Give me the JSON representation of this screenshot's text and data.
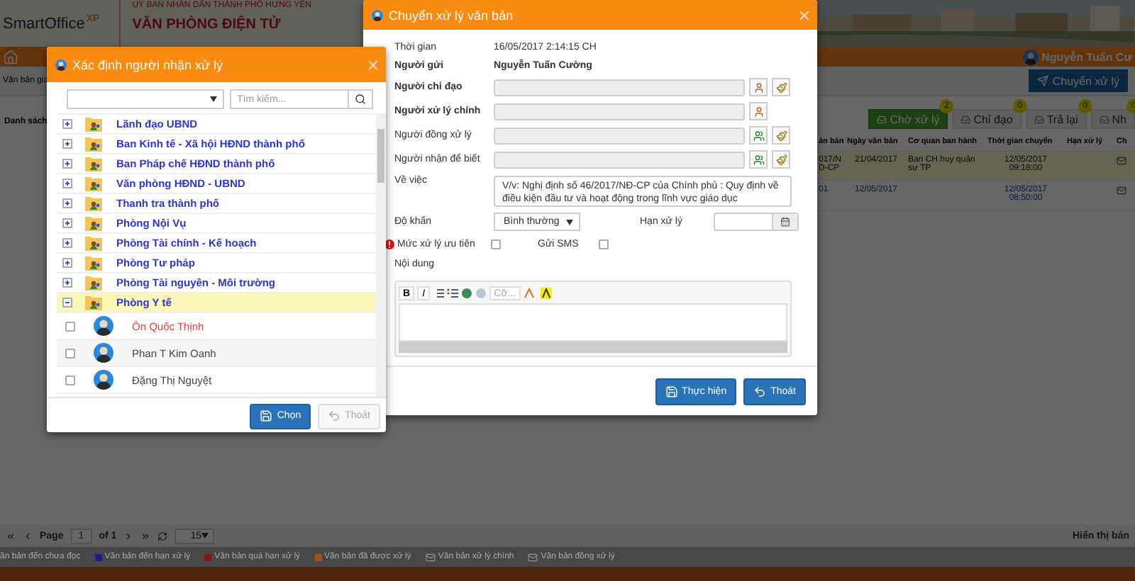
{
  "banner": {
    "logo": "SmartOffice",
    "logo_suffix": "XP",
    "org": "UỶ BAN NHÂN DÂN THÀNH PHỐ HƯNG YÊN",
    "title": "VĂN PHÒNG ĐIỆN TỬ"
  },
  "navbar": {
    "user": "Nguyễn Tuấn Cư"
  },
  "toolbar": {
    "breadcrumb": "Văn bản gia",
    "action": "Chuyển xử lý"
  },
  "list": {
    "title": "Danh sách",
    "tabs": [
      {
        "label": "Chờ xử lý",
        "badge": "2",
        "selected": true
      },
      {
        "label": "Chỉ đạo",
        "badge": "0",
        "selected": false
      },
      {
        "label": "Trả lại",
        "badge": "0",
        "selected": false
      },
      {
        "label": "Nh",
        "badge": "0",
        "selected": false
      }
    ]
  },
  "table": {
    "columns": [
      "ản bản",
      "Ngày văn bản",
      "Cơ quan ban hành",
      "Thời gian chuyển",
      "Hạn xử lý",
      "Ch"
    ],
    "rows": [
      {
        "selected": true,
        "unread": false,
        "number": "017/ND-CP",
        "date": "21/04/2017",
        "issuer": "Ban CH huy quân sự TP",
        "sent": "12/05/2017 09:18:00"
      },
      {
        "selected": false,
        "unread": true,
        "number": "01",
        "date": "12/05/2017",
        "sent": "12/05/2017 08:50:00"
      }
    ]
  },
  "pager": {
    "page_label": "Page",
    "page": "1",
    "of": "of 1",
    "page_size": "15",
    "summary": "Hiển thị bản"
  },
  "legend": [
    {
      "kind": "text",
      "label": "ăn bản đến chưa đọc"
    },
    {
      "kind": "swatch",
      "color": "#1c1c8c",
      "label": "Văn bản đến hạn xử lý"
    },
    {
      "kind": "swatch",
      "color": "#8c1414",
      "label": "Văn bản quá hạn xử lý"
    },
    {
      "kind": "swatch",
      "color": "#a0501c",
      "label": "Văn bản đã được xử lý"
    },
    {
      "kind": "icon",
      "label": "Văn bản xử lý chính"
    },
    {
      "kind": "icon",
      "label": "Văn bản đồng xử lý"
    }
  ],
  "transfer_dialog": {
    "title": "Chuyển xử lý văn bản",
    "fields": [
      {
        "kind": "info",
        "label": "Thời gian",
        "value": "16/05/2017 2:14:15 CH",
        "bold": false
      },
      {
        "kind": "info",
        "label": "Người gửi",
        "value": "Nguyễn Tuấn Cường",
        "bold": true
      },
      {
        "kind": "picker",
        "label": "Người chỉ đạo",
        "bold": true,
        "multiple": false,
        "clearable": true
      },
      {
        "kind": "picker",
        "label": "Người xử lý chính",
        "bold": true,
        "multiple": false,
        "clearable": false
      },
      {
        "kind": "picker",
        "label": "Người đồng xử lý",
        "bold": false,
        "multiple": true,
        "clearable": true
      },
      {
        "kind": "picker",
        "label": "Người nhận để biết",
        "bold": false,
        "multiple": true,
        "clearable": true
      }
    ],
    "subject": {
      "label": "Về việc",
      "value": "V/v: Nghị định số 46/2017/NĐ-CP của Chính phủ : Quy định về điều kiện đầu tư và hoạt động trong lĩnh vực giáo dục"
    },
    "urgency": {
      "label": "Độ khẩn",
      "value": "Bình thường"
    },
    "deadline": {
      "label": "Hạn xử lý"
    },
    "priority": {
      "label": "Mức xử lý ưu tiên",
      "checked": false
    },
    "sms": {
      "label": "Gửi SMS",
      "checked": false
    },
    "content": {
      "label": "Nội dung",
      "bold_tool": "B",
      "italic_tool": "I",
      "size_placeholder": "Cỡ..."
    },
    "buttons": [
      {
        "kind": "save",
        "label": "Thực hiện"
      },
      {
        "kind": "back",
        "label": "Thoát"
      }
    ]
  },
  "recipient_dialog": {
    "title": "Xác định người nhận xử lý",
    "search": {
      "placeholder": "Tìm kiếm..."
    },
    "groups": [
      {
        "name": "Lãnh đạo UBND",
        "expanded": false,
        "selected": false
      },
      {
        "name": "Ban Kinh tế - Xã hội HĐND thành phố",
        "expanded": false,
        "selected": false
      },
      {
        "name": "Ban Pháp chế HĐND thành phố",
        "expanded": false,
        "selected": false
      },
      {
        "name": "Văn phòng HĐND - UBND",
        "expanded": false,
        "selected": false
      },
      {
        "name": "Thanh tra thành phố",
        "expanded": false,
        "selected": false
      },
      {
        "name": "Phòng Nội Vụ",
        "expanded": false,
        "selected": false
      },
      {
        "name": "Phòng Tài chính - Kế hoạch",
        "expanded": false,
        "selected": false
      },
      {
        "name": "Phòng Tư pháp",
        "expanded": false,
        "selected": false
      },
      {
        "name": "Phòng Tài nguyên - Môi trường",
        "expanded": false,
        "selected": false
      },
      {
        "name": "Phòng Y tế",
        "expanded": true,
        "selected": true,
        "children": [
          {
            "name": "Ôn Quốc Thịnh",
            "checked": false,
            "color": "#f03c3c"
          },
          {
            "name": "Phan T Kim Oanh",
            "checked": false,
            "color": "#444444"
          },
          {
            "name": "Đặng Thị Nguyệt",
            "checked": false,
            "color": "#444444"
          }
        ]
      }
    ],
    "buttons": [
      {
        "kind": "save",
        "label": "Chọn",
        "disabled": false
      },
      {
        "kind": "back",
        "label": "Thoát",
        "disabled": true
      }
    ]
  }
}
